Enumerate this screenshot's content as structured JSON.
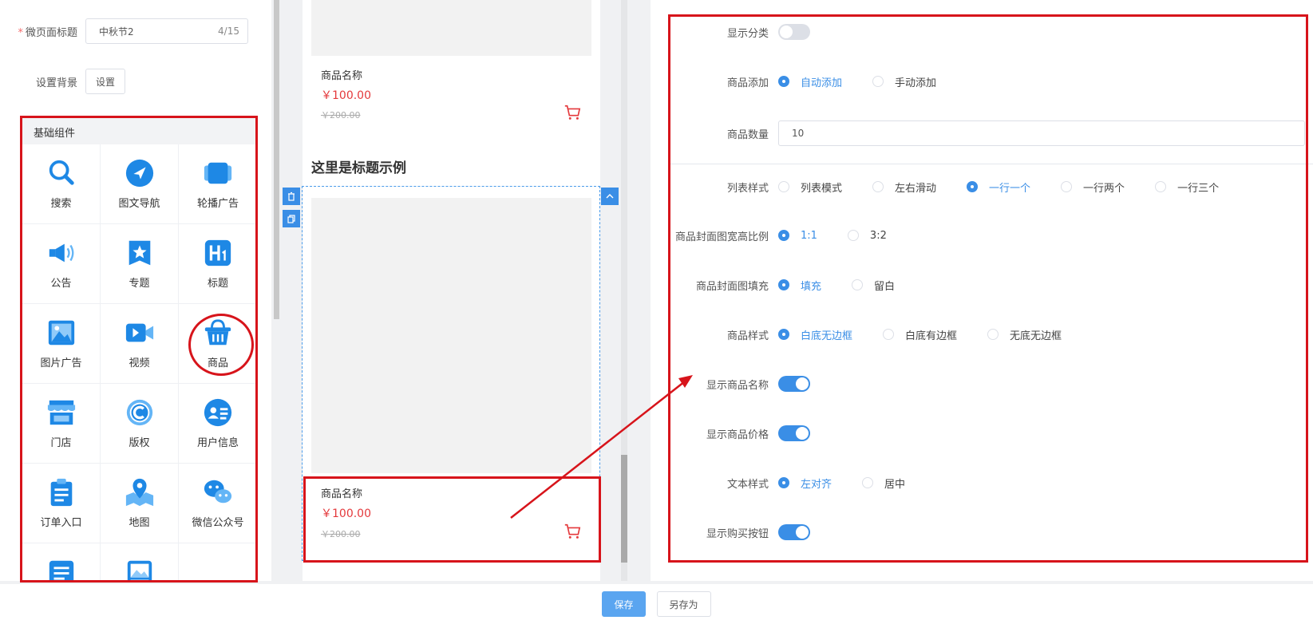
{
  "page_settings": {
    "title_label": "微页面标题",
    "title_value": "中秋节2",
    "title_count": "4/15",
    "bg_label": "设置背景",
    "bg_button": "设置"
  },
  "components": {
    "header": "基础组件",
    "items": [
      {
        "label": "搜索",
        "icon": "search-icon"
      },
      {
        "label": "图文导航",
        "icon": "navigation-icon"
      },
      {
        "label": "轮播广告",
        "icon": "carousel-icon"
      },
      {
        "label": "公告",
        "icon": "megaphone-icon"
      },
      {
        "label": "专题",
        "icon": "topic-icon"
      },
      {
        "label": "标题",
        "icon": "heading-icon"
      },
      {
        "label": "图片广告",
        "icon": "image-icon"
      },
      {
        "label": "视频",
        "icon": "video-icon"
      },
      {
        "label": "商品",
        "icon": "basket-icon"
      },
      {
        "label": "门店",
        "icon": "store-icon"
      },
      {
        "label": "版权",
        "icon": "copyright-icon"
      },
      {
        "label": "用户信息",
        "icon": "user-card-icon"
      },
      {
        "label": "订单入口",
        "icon": "clipboard-icon"
      },
      {
        "label": "地图",
        "icon": "map-icon"
      },
      {
        "label": "微信公众号",
        "icon": "wechat-icon"
      },
      {
        "label": "",
        "icon": "article-icon"
      },
      {
        "label": "",
        "icon": "picture-icon"
      },
      {
        "label": "",
        "icon": ""
      }
    ]
  },
  "preview": {
    "product1": {
      "name": "商品名称",
      "price": "￥100.00",
      "old_price": "￥200.00"
    },
    "section_title": "这里是标题示例",
    "product2": {
      "name": "商品名称",
      "price": "￥100.00",
      "old_price": "￥200.00"
    }
  },
  "settings": {
    "show_category_label": "显示分类",
    "add_label": "商品添加",
    "add_options": [
      "自动添加",
      "手动添加"
    ],
    "qty_label": "商品数量",
    "qty_value": "10",
    "list_style_label": "列表样式",
    "list_style_options": [
      "列表模式",
      "左右滑动",
      "一行一个",
      "一行两个",
      "一行三个"
    ],
    "ratio_label": "商品封面图宽高比例",
    "ratio_options": [
      "1:1",
      "3:2"
    ],
    "fill_label": "商品封面图填充",
    "fill_options": [
      "填充",
      "留白"
    ],
    "style_label": "商品样式",
    "style_options": [
      "白底无边框",
      "白底有边框",
      "无底无边框"
    ],
    "show_name_label": "显示商品名称",
    "show_price_label": "显示商品价格",
    "text_style_label": "文本样式",
    "text_style_options": [
      "左对齐",
      "居中"
    ],
    "show_buy_label": "显示购买按钮"
  },
  "footer": {
    "save": "保存",
    "save_as": "另存为"
  },
  "colors": {
    "accent": "#3a8ee6",
    "price": "#e4393c",
    "highlight": "#d7141b"
  }
}
